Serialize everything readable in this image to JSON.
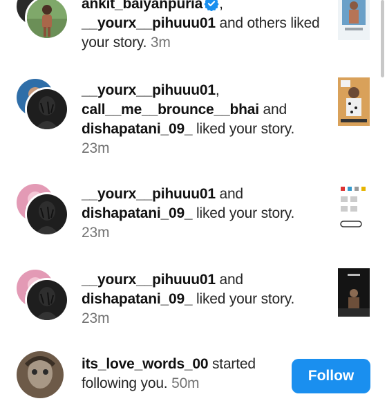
{
  "notifications": [
    {
      "user1": "ankit_baiyanpuria",
      "user2": "__yourx__pihuuu01",
      "rest": " and others liked your story.",
      "time": "3m"
    },
    {
      "user1": "__yourx__pihuuu01",
      "user2": "call__me__brounce__bhai",
      "user3": "dishapatani_09_",
      "rest": " liked your story.",
      "time": "23m"
    },
    {
      "user1": "__yourx__pihuuu01",
      "user2": "dishapatani_09_",
      "rest": " liked your story.",
      "time": "23m"
    },
    {
      "user1": "__yourx__pihuuu01",
      "user2": "dishapatani_09_",
      "rest": " liked your story.",
      "time": "23m"
    },
    {
      "user1": "its_love_words_00",
      "rest": " started following you.",
      "time": "50m"
    }
  ],
  "joiners": {
    "comma": ",",
    "and": " and "
  },
  "follow_button": {
    "label": "Follow"
  },
  "colors": {
    "accent": "#1a8fef",
    "verified": "#1a8fef",
    "muted": "#737373"
  },
  "icons": {
    "verified": "verified-badge-icon"
  }
}
